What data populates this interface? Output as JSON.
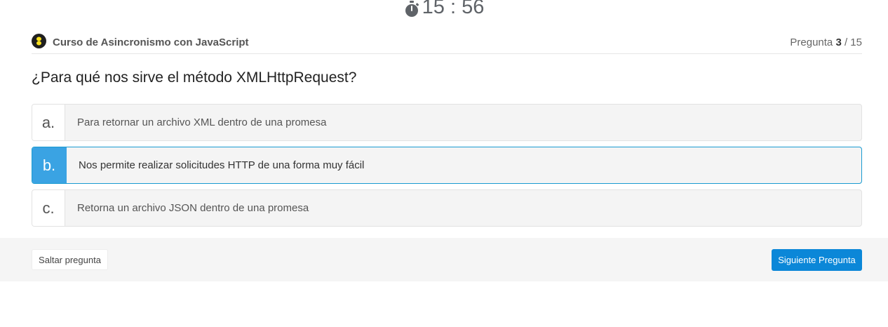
{
  "timer": {
    "icon": "stopwatch-icon",
    "time": "15 : 56"
  },
  "header": {
    "course_icon": "course-badge-icon",
    "course_title": "Curso de Asincronismo con JavaScript",
    "progress_prefix": "Pregunta",
    "progress_current": "3",
    "progress_total": "/ 15"
  },
  "question": "¿Para qué nos sirve el método XMLHttpRequest?",
  "options": [
    {
      "letter": "a.",
      "text": "Para retornar un archivo XML dentro de una promesa",
      "selected": false
    },
    {
      "letter": "b.",
      "text": "Nos permite realizar solicitudes HTTP de una forma muy fácil",
      "selected": true
    },
    {
      "letter": "c.",
      "text": "Retorna un archivo JSON dentro de una promesa",
      "selected": false
    }
  ],
  "footer": {
    "skip_label": "Saltar pregunta",
    "next_label": "Siguiente Pregunta"
  },
  "colors": {
    "accent": "#3aa3e3",
    "selected_border": "#1a9bd1",
    "primary_button": "#0b87d8"
  }
}
